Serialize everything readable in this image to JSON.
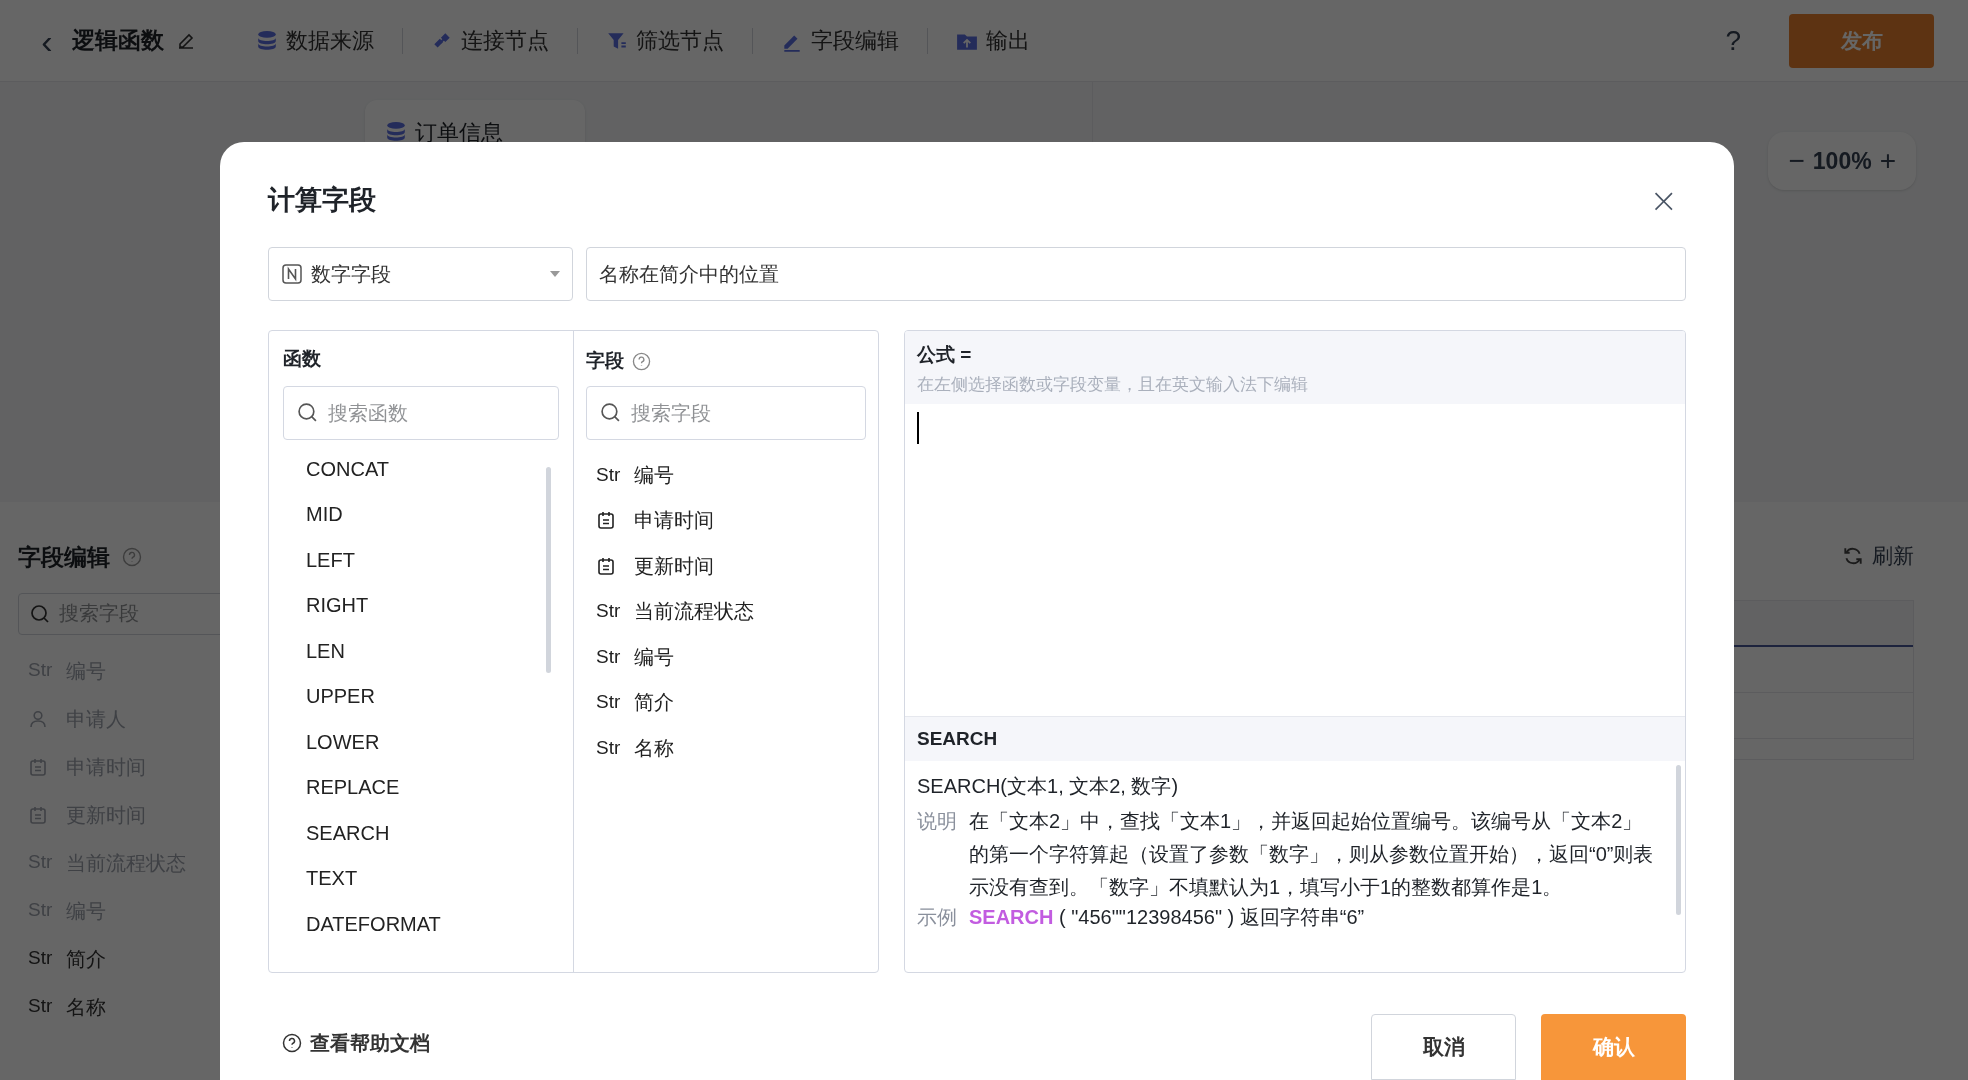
{
  "topbar": {
    "back": "‹",
    "title": "逻辑函数",
    "nav": [
      "数据来源",
      "连接节点",
      "筛选节点",
      "字段编辑",
      "输出"
    ],
    "help": "?",
    "publish": "发布"
  },
  "canvas": {
    "node": "订单信息",
    "zoom_out": "−",
    "zoom": "100%",
    "zoom_in": "+"
  },
  "side_panel": {
    "title": "字段编辑",
    "search_placeholder": "搜索字段",
    "refresh": "刷新",
    "fields": [
      {
        "kind": "str",
        "prefix": "Str",
        "name": "编号",
        "disabled": true
      },
      {
        "kind": "person",
        "name": "申请人",
        "disabled": true
      },
      {
        "kind": "date",
        "name": "申请时间",
        "disabled": true
      },
      {
        "kind": "date",
        "name": "更新时间",
        "disabled": true
      },
      {
        "kind": "str",
        "prefix": "Str",
        "name": "当前流程状态",
        "disabled": true
      },
      {
        "kind": "str",
        "prefix": "Str",
        "name": "编号",
        "disabled": true
      },
      {
        "kind": "str",
        "prefix": "Str",
        "name": "简介",
        "disabled": false
      },
      {
        "kind": "str",
        "prefix": "Str",
        "name": "名称",
        "disabled": false
      }
    ]
  },
  "dialog": {
    "title": "计算字段",
    "close": "×",
    "field_type": "数字字段",
    "name_value": "名称在简介中的位置",
    "functions": {
      "title": "函数",
      "search_placeholder": "搜索函数",
      "items": [
        "CONCAT",
        "MID",
        "LEFT",
        "RIGHT",
        "LEN",
        "UPPER",
        "LOWER",
        "REPLACE",
        "SEARCH",
        "TEXT",
        "DATEFORMAT"
      ]
    },
    "fields": {
      "title": "字段",
      "search_placeholder": "搜索字段",
      "items": [
        {
          "kind": "str",
          "prefix": "Str",
          "name": "编号"
        },
        {
          "kind": "date",
          "name": "申请时间"
        },
        {
          "kind": "date",
          "name": "更新时间"
        },
        {
          "kind": "str",
          "prefix": "Str",
          "name": "当前流程状态"
        },
        {
          "kind": "str",
          "prefix": "Str",
          "name": "编号"
        },
        {
          "kind": "str",
          "prefix": "Str",
          "name": "简介"
        },
        {
          "kind": "str",
          "prefix": "Str",
          "name": "名称"
        }
      ]
    },
    "formula": {
      "label": "公式 =",
      "hint": "在左侧选择函数或字段变量，且在英文输入法下编辑"
    },
    "doc": {
      "name": "SEARCH",
      "signature": "SEARCH(文本1, 文本2, 数字)",
      "desc_label": "说明",
      "desc": "在「文本2」中，查找「文本1」，并返回起始位置编号。该编号从「文本2」的第一个字符算起（设置了参数「数字」，则从参数位置开始），返回“0”则表示没有查到。「数字」不填默认为1，填写小于1的整数都算作是1。",
      "example_label": "示例",
      "example_fn": "SEARCH",
      "example_rest": "( \"456\"\"12398456\" ) 返回字符串“6”"
    },
    "help_link": "查看帮助文档",
    "cancel": "取消",
    "confirm": "确认"
  }
}
